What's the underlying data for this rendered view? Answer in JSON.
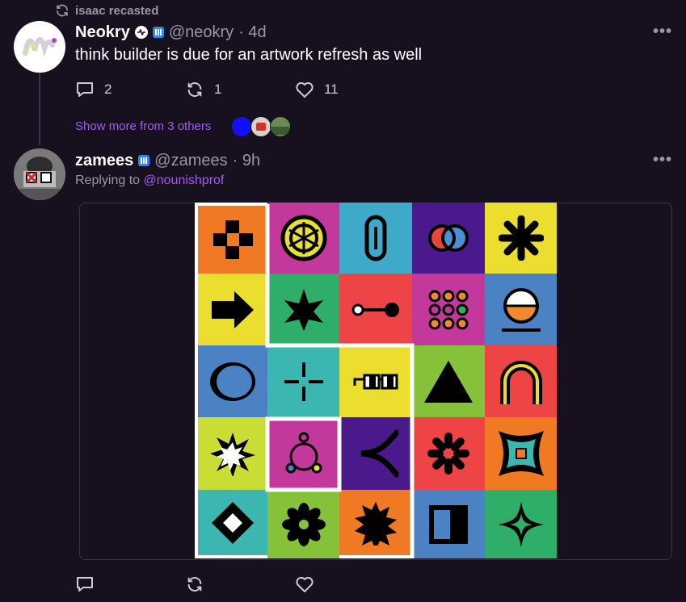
{
  "recast": {
    "icon": "recast-icon",
    "text": "isaac recasted"
  },
  "post1": {
    "author_name": "Neokry",
    "handle": "@neokry",
    "time": "· 4d",
    "text": "think builder is due for an artwork refresh as well",
    "replies": "2",
    "recasts": "1",
    "likes": "11",
    "more": "•••"
  },
  "thread": {
    "show_more": "Show more from 3 others"
  },
  "post2": {
    "author_name": "zamees",
    "handle": "@zamees",
    "time": "· 9h",
    "replying_prefix": "Replying to",
    "replying_to": "@nounishprof",
    "more": "•••"
  },
  "colors": {
    "background": "#17101f",
    "accent_purple": "#a35cf1",
    "badge_blue": "#2c87f4",
    "muted": "#9b95a6"
  },
  "artwork": {
    "grid": [
      [
        "orange",
        "magenta",
        "cyan",
        "purple",
        "yellow"
      ],
      [
        "yellow",
        "green",
        "red",
        "magenta",
        "blue"
      ],
      [
        "blue",
        "teal",
        "yellow",
        "lime",
        "red"
      ],
      [
        "lime",
        "magenta",
        "purple",
        "red",
        "orange"
      ],
      [
        "teal",
        "lime",
        "orange",
        "blue",
        "green"
      ]
    ]
  }
}
